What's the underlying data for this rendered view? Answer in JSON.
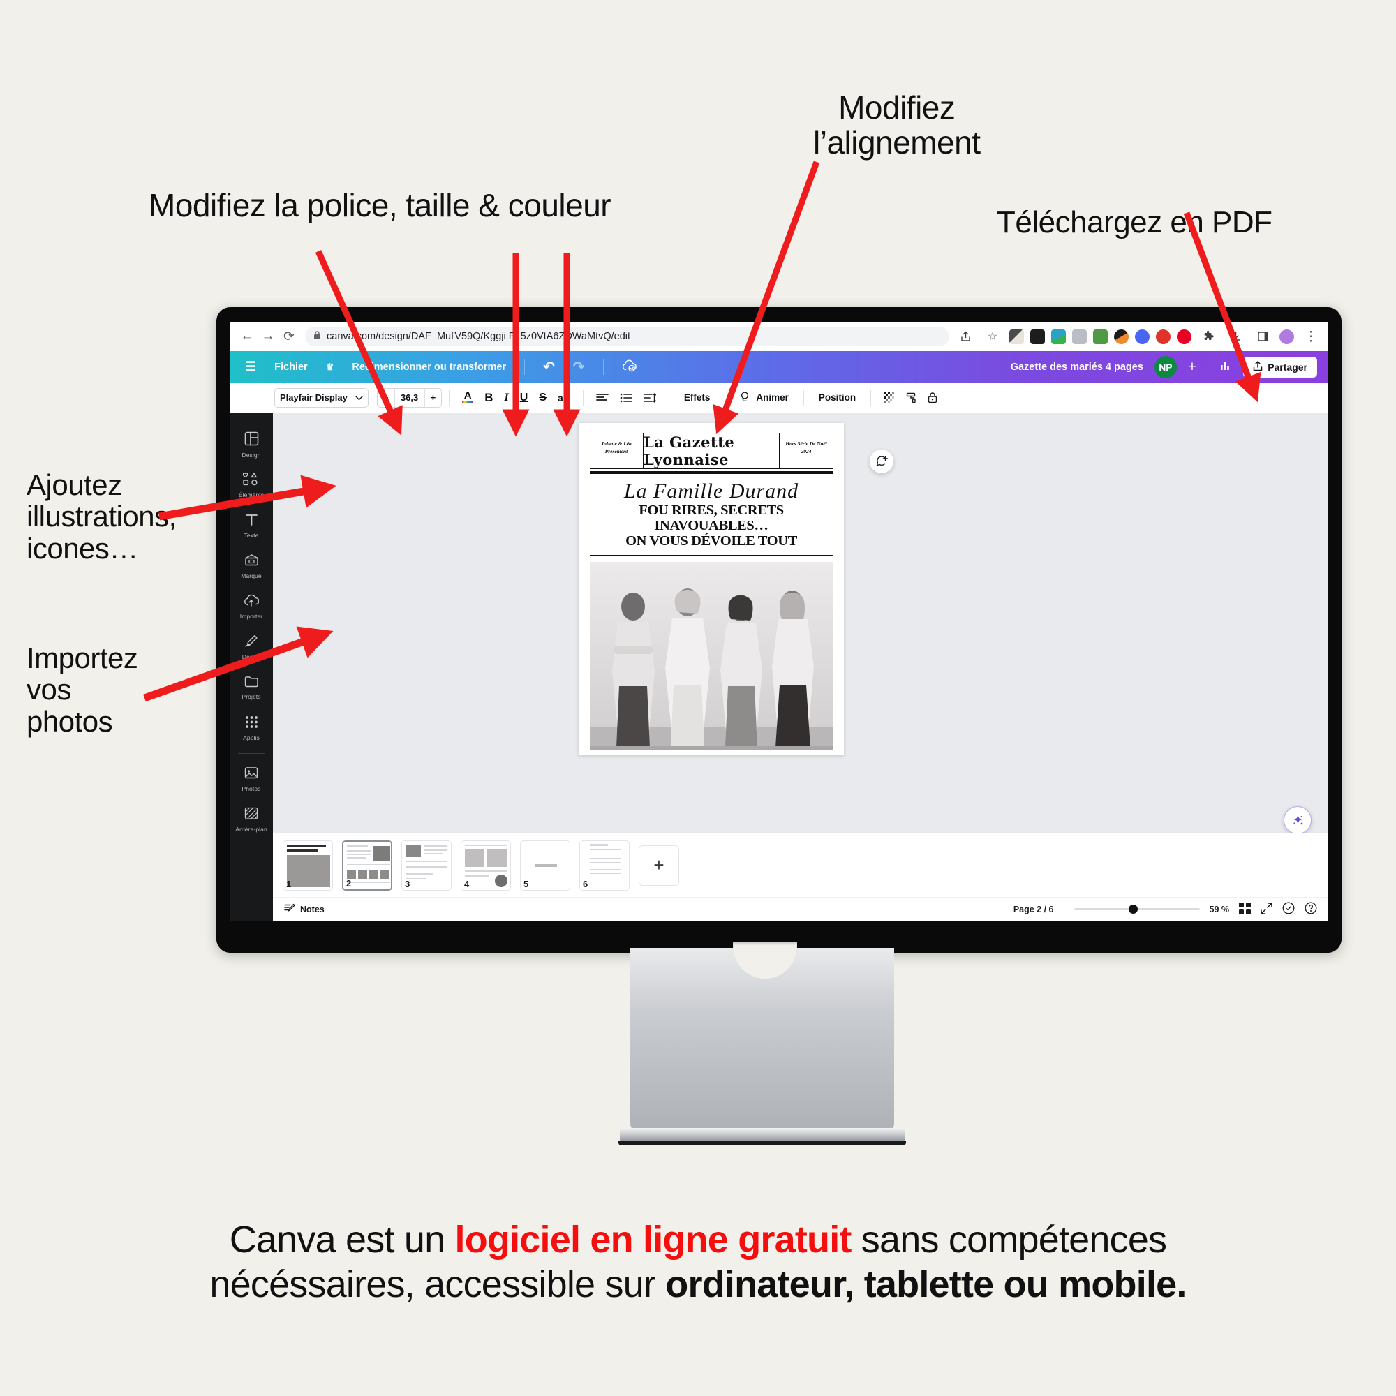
{
  "annotations": {
    "align": "Modifiez\nl’alignement",
    "font": "Modifiez la police, taille & couleur",
    "pdf": "Téléchargez en PDF",
    "elements": "Ajoutez\nillustrations,\nicones…",
    "import": "Importez\nvos\nphotos"
  },
  "browser": {
    "back_icon": "←",
    "forward_icon": "→",
    "reload_icon": "⟳",
    "url": "canva.com/design/DAF_Muf V59Q/Kggji F15z0VtA6ZDWaMtvQ/edit",
    "lock_icon": "lock-icon",
    "share_icon": "↑",
    "bookmark_icon": "☆",
    "menu_icon": "⋮",
    "extension_colors": [
      "#cfd2d6",
      "#1d1d1d",
      "#2aa3c7",
      "#b8bec4",
      "#4f9a44",
      "#f07a1a",
      "#4a66f0",
      "#e0342b",
      "#e60023",
      "#3c3c3c",
      "#3c3c3c",
      "#3c3c3c",
      "#b07be0"
    ]
  },
  "canva_header": {
    "menu_icon": "☰",
    "file": "Fichier",
    "crown_icon": "♛",
    "resize": "Redimensionner ou transformer",
    "undo_icon": "↶",
    "redo_icon": "↷",
    "cloud_icon": "cloud-check-icon",
    "doc_title": "Gazette des mariés 4 pages",
    "avatar_initials": "NP",
    "avatar_color": "#0a8a3f",
    "add_user": "+",
    "insights_icon": "insights-icon",
    "share_label": "Partager",
    "share_icon": "↑"
  },
  "text_toolbar": {
    "font_family": "Playfair Display",
    "chevron": "⌄",
    "minus": "−",
    "font_size": "36,3",
    "plus": "+",
    "text_color_icon": "A",
    "bold": "B",
    "italic": "I",
    "underline": "U",
    "strike": "S",
    "case": "aA",
    "align_icon": "align-left-icon",
    "list_icon": "bullet-list-icon",
    "spacing_icon": "line-spacing-icon",
    "effects": "Effets",
    "animate": "Animer",
    "position": "Position",
    "transparency_icon": "transparency-icon",
    "copy_style_icon": "paint-roller-icon",
    "lock_icon": "lock-icon"
  },
  "rail": {
    "items": [
      {
        "label": "Design",
        "icon": "design-icon"
      },
      {
        "label": "Éléments",
        "icon": "elements-icon"
      },
      {
        "label": "Texte",
        "icon": "text-icon"
      },
      {
        "label": "Marque",
        "icon": "brand-icon"
      },
      {
        "label": "Importer",
        "icon": "upload-icon"
      },
      {
        "label": "Dessin",
        "icon": "draw-icon"
      },
      {
        "label": "Projets",
        "icon": "projects-icon"
      },
      {
        "label": "Applis",
        "icon": "apps-icon"
      },
      {
        "label": "Photos",
        "icon": "photos-icon"
      },
      {
        "label": "Arrière-plan",
        "icon": "background-icon"
      }
    ]
  },
  "design": {
    "masthead_left": "Juliette & Léa\nPrésentent",
    "masthead_title": "La Gazette Lyonnaise",
    "masthead_right": "Hors Série\nDe Noël 2024",
    "script_title": "La Famille Durand",
    "headline_1": "FOU RIRES, SECRETS INAVOUABLES…",
    "headline_2": "ON VOUS DÉVOILE TOUT"
  },
  "floating": {
    "comment_icon": "add-comment-icon",
    "magic_icon": "magic-sparkle-icon"
  },
  "thumbnails": {
    "pages": [
      "1",
      "2",
      "3",
      "4",
      "5",
      "6"
    ],
    "selected": "2",
    "add_label": "+"
  },
  "status_bar": {
    "notes": "Notes",
    "notes_icon": "notes-icon",
    "page_indicator": "Page 2 / 6",
    "zoom": "59 %",
    "grid_icon": "grid-view-icon",
    "fullscreen_icon": "fullscreen-icon",
    "check_icon": "check-circle-icon",
    "help_icon": "help-circle-icon"
  },
  "caption": {
    "part1": "Canva est un ",
    "highlight": "logiciel en ligne gratuit",
    "part2": " sans compétences",
    "part3": "nécéssaires, accessible sur ",
    "bold": "ordinateur, tablette ou mobile."
  },
  "colors": {
    "background": "#f2f0eb",
    "accent_red": "#f40e0e",
    "arrow_red": "#ee1c1c"
  }
}
